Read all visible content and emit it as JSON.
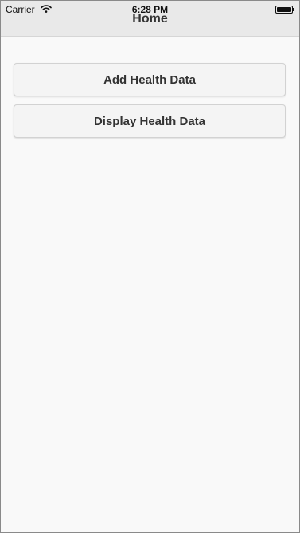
{
  "status_bar": {
    "carrier": "Carrier",
    "time": "6:28 PM",
    "wifi_icon": "wifi-icon",
    "battery_icon": "battery-icon"
  },
  "nav_bar": {
    "title": "Home"
  },
  "buttons": {
    "add_health_data": "Add Health Data",
    "display_health_data": "Display Health Data"
  },
  "colors": {
    "nav_background": "#e9e9e9",
    "page_background": "#f9f9f9",
    "button_background": "#f4f4f4",
    "text": "#333333"
  }
}
